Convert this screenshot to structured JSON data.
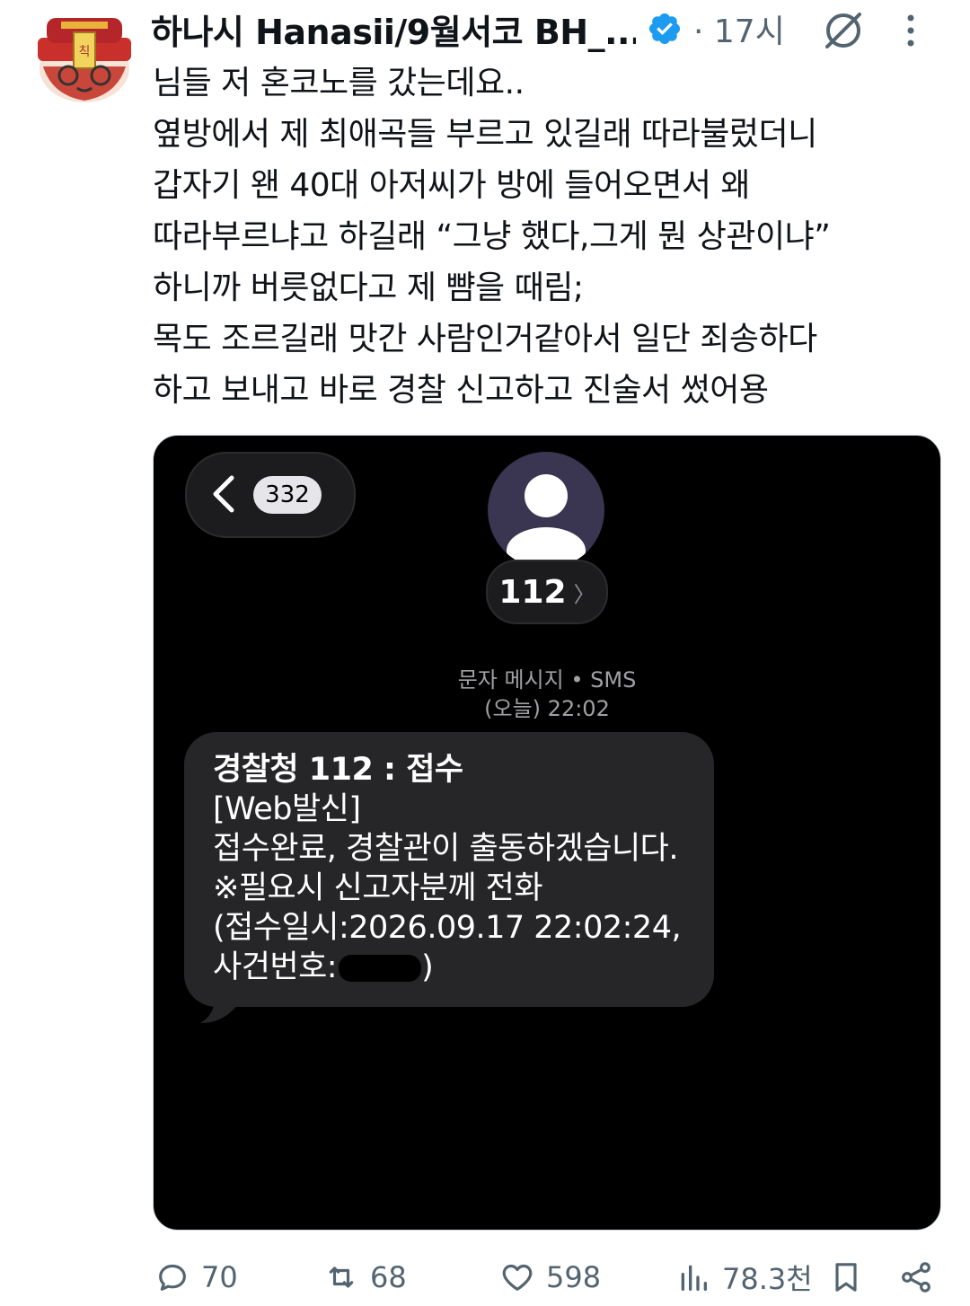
{
  "post": {
    "author_name": "하나시 Hanasii/9월서코 BH_...",
    "time": "· 17시",
    "text": "님들 저 혼코노를 갔는데요..\n옆방에서 제 최애곡들 부르고 있길래 따라불렀더니\n갑자기 왠 40대 아저씨가 방에 들어오면서 왜\n따라부르냐고 하길래 “그냥 했다,그게 뭔 상관이냐”\n하니까 버릇없다고 제 뺨을 때림;\n목도 조르길래 맛간 사람인거같아서 일단 죄송하다\n하고 보내고 바로 경찰 신고하고 진술서 썼어용"
  },
  "screenshot": {
    "back_badge": "332",
    "contact": "112",
    "meta_line1": "문자 메시지 • SMS",
    "meta_line2": "(오늘) 22:02",
    "message": {
      "line1": "경찰청 112 : 접수",
      "line2": "[Web발신]",
      "line3": "접수완료, 경찰관이 출동하겠습니다.",
      "line4": "※필요시 신고자분께 전화",
      "line5": "(접수일시:2026.09.17 22:02:24,",
      "line6_prefix": "사건번호:",
      "line6_suffix": ")"
    }
  },
  "actions": {
    "replies": "70",
    "reposts": "68",
    "likes": "598",
    "views": "78.3천"
  },
  "colors": {
    "verified": "#1d9bf0",
    "muted": "#536471",
    "bubble": "#262628",
    "contact_avatar": "#3a3550"
  }
}
